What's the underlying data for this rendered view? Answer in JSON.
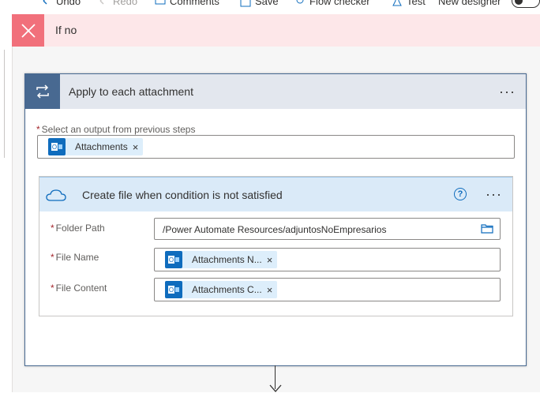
{
  "toolbar": {
    "undo": "Undo",
    "redo": "Redo",
    "comments": "Comments",
    "save": "Save",
    "flow_checker": "Flow checker",
    "test": "Test",
    "new_designer": "New designer"
  },
  "branch": {
    "label": "If no",
    "color": "#fde7e9",
    "icon_color": "#f1707b"
  },
  "apply_to_each": {
    "title": "Apply to each attachment",
    "header_color": "#e3e7ee",
    "icon_color": "#486991",
    "output_label": "Select an output from previous steps",
    "required_mark": "*",
    "token": "Attachments",
    "token_remove": "×",
    "more": "···"
  },
  "create_file": {
    "title": "Create file when condition is not satisfied",
    "help": "?",
    "more": "···",
    "fields": [
      {
        "label": "Folder Path",
        "value": "/Power Automate Resources/adjuntosNoEmpresarios"
      },
      {
        "label": "File Name",
        "token": "Attachments N...",
        "remove": "×"
      },
      {
        "label": "File Content",
        "token": "Attachments C...",
        "remove": "×"
      }
    ]
  },
  "icons": {
    "undo": "undo-icon",
    "redo": "redo-icon",
    "comments": "comment-icon",
    "save": "save-icon",
    "flow_checker": "stethoscope-icon",
    "test": "flask-icon",
    "branch_close": "close-icon",
    "loop": "loop-icon",
    "outlook": "outlook-icon",
    "onedrive": "onedrive-cloud-icon",
    "folder": "folder-icon"
  }
}
